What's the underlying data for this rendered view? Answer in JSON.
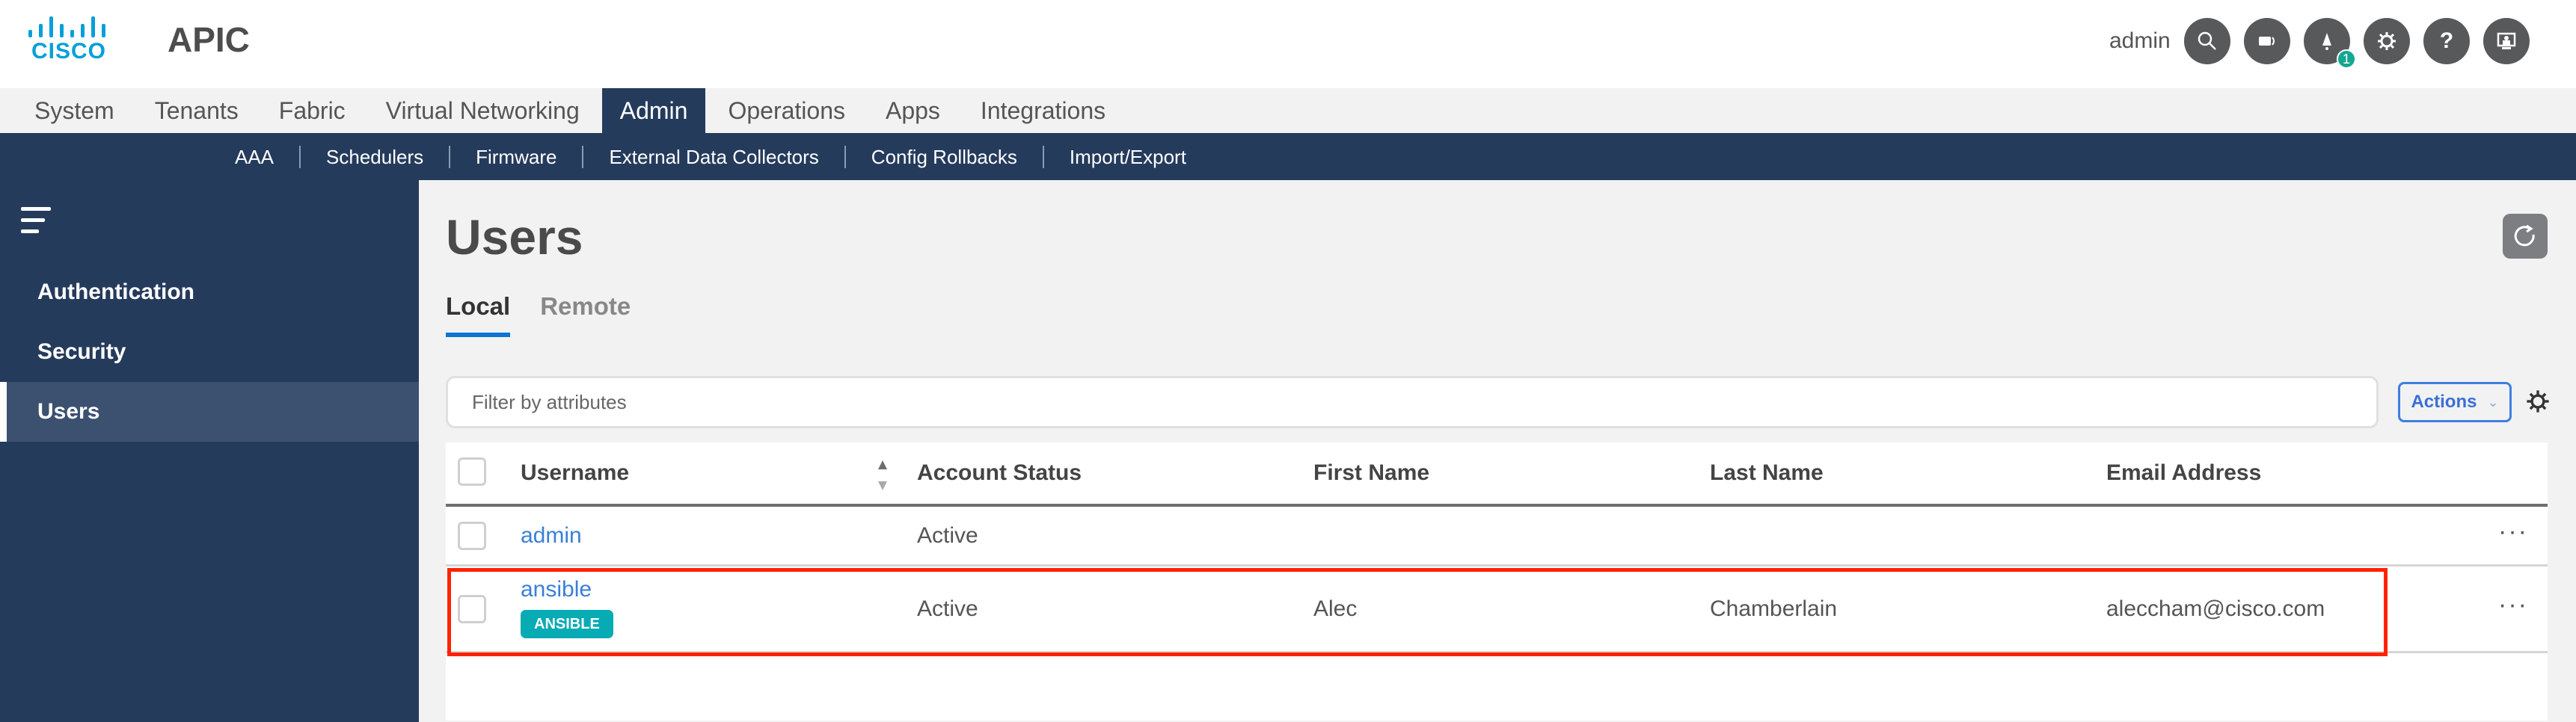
{
  "header": {
    "logo_text": "CISCO",
    "app_title": "APIC",
    "user": "admin",
    "icons": [
      {
        "name": "search-icon"
      },
      {
        "name": "chat-icon"
      },
      {
        "name": "bell-icon",
        "badge": "1"
      },
      {
        "name": "gear-icon"
      },
      {
        "name": "help-icon"
      },
      {
        "name": "screen-user-icon"
      }
    ]
  },
  "nav": {
    "tabs": [
      "System",
      "Tenants",
      "Fabric",
      "Virtual Networking",
      "Admin",
      "Operations",
      "Apps",
      "Integrations"
    ],
    "active": "Admin"
  },
  "subnav": {
    "items": [
      "AAA",
      "Schedulers",
      "Firmware",
      "External Data Collectors",
      "Config Rollbacks",
      "Import/Export"
    ]
  },
  "sidebar": {
    "items": [
      "Authentication",
      "Security",
      "Users"
    ],
    "active": "Users"
  },
  "main": {
    "title": "Users",
    "tabs": [
      "Local",
      "Remote"
    ],
    "active_tab": "Local",
    "filter_placeholder": "Filter by attributes",
    "actions_label": "Actions"
  },
  "table": {
    "columns": [
      "Username",
      "Account Status",
      "First Name",
      "Last Name",
      "Email Address"
    ],
    "rows": [
      {
        "username": "admin",
        "tag": "",
        "status": "Active",
        "first": "",
        "last": "",
        "email": ""
      },
      {
        "username": "ansible",
        "tag": "ANSIBLE",
        "status": "Active",
        "first": "Alec",
        "last": "Chamberlain",
        "email": "aleccham@cisco.com"
      }
    ],
    "more_label": "···"
  },
  "colors": {
    "navy": "#253b5c",
    "link": "#3a7fd8",
    "tag": "#06abb4",
    "highlight": "#ff2200",
    "accent_tab": "#0d74d1"
  }
}
